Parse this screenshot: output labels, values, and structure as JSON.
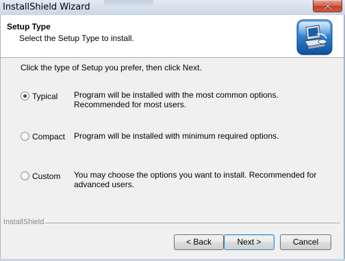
{
  "window": {
    "title": "InstallShield Wizard"
  },
  "header": {
    "title": "Setup Type",
    "subtitle": "Select the Setup Type to install.",
    "icon": "computer-setup-icon"
  },
  "main": {
    "instruction": "Click the type of Setup you prefer, then click Next.",
    "options": [
      {
        "label": "Typical",
        "description": "Program will be installed with the most common options.  Recommended for most users.",
        "selected": true
      },
      {
        "label": "Compact",
        "description": "Program will be installed with minimum required options.",
        "selected": false
      },
      {
        "label": "Custom",
        "description": "You may choose the options you want to install. Recommended for advanced users.",
        "selected": false
      }
    ]
  },
  "footer": {
    "brand": "InstallShield",
    "back_label": "< Back",
    "next_label": "Next >",
    "cancel_label": "Cancel"
  },
  "colors": {
    "close_button": "#c3402a",
    "default_button_border": "#3c7fb1",
    "header_background": "#ffffff",
    "dialog_background": "#f0f0f0"
  }
}
